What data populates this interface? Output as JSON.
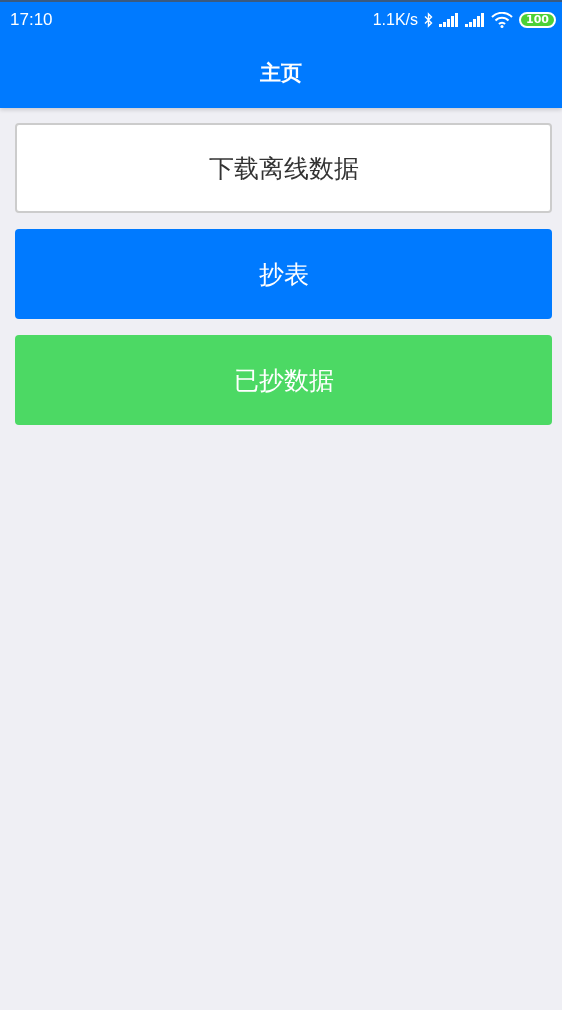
{
  "status_bar": {
    "time": "17:10",
    "net_speed": "1.1K/s",
    "battery": "100"
  },
  "header": {
    "title": "主页"
  },
  "buttons": [
    {
      "label": "下载离线数据",
      "kind": "outline"
    },
    {
      "label": "抄表",
      "kind": "primary"
    },
    {
      "label": "已抄数据",
      "kind": "success"
    }
  ]
}
